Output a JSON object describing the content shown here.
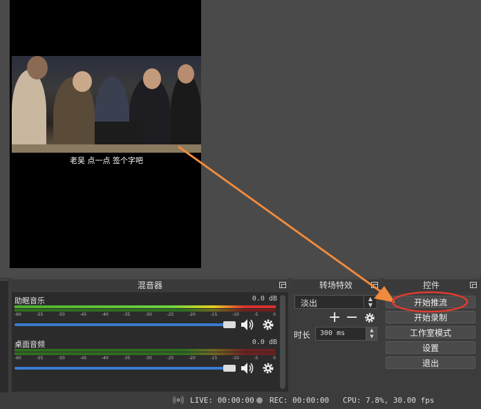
{
  "preview": {
    "subtitle": "老吴 点一点 签个字吧"
  },
  "mixer": {
    "title": "混音器",
    "tracks": [
      {
        "name": "助眠音乐",
        "db": "0.0 dB",
        "scale": [
          "-60",
          "-55",
          "-50",
          "-45",
          "-40",
          "-35",
          "-30",
          "-25",
          "-20",
          "-15",
          "-10",
          "-5",
          "0"
        ]
      },
      {
        "name": "桌面音频",
        "db": "0.0 dB",
        "scale": [
          "-60",
          "-55",
          "-50",
          "-45",
          "-40",
          "-35",
          "-30",
          "-25",
          "-20",
          "-15",
          "-10",
          "-5",
          "0"
        ]
      }
    ]
  },
  "transitions": {
    "title": "转场特效",
    "selected": "淡出",
    "duration_label": "时长",
    "duration_value": "300 ms"
  },
  "controls": {
    "title": "控件",
    "start_stream": "开始推流",
    "start_record": "开始录制",
    "studio_mode": "工作室模式",
    "settings": "设置",
    "exit": "退出"
  },
  "status": {
    "live": "LIVE: 00:00:00",
    "rec": "REC: 00:00:00",
    "cpu": "CPU: 7.8%, 30.00 fps"
  },
  "colors": {
    "annotation": "#f08a3c",
    "circle": "#e23b2e",
    "accent": "#3b7ad0"
  }
}
